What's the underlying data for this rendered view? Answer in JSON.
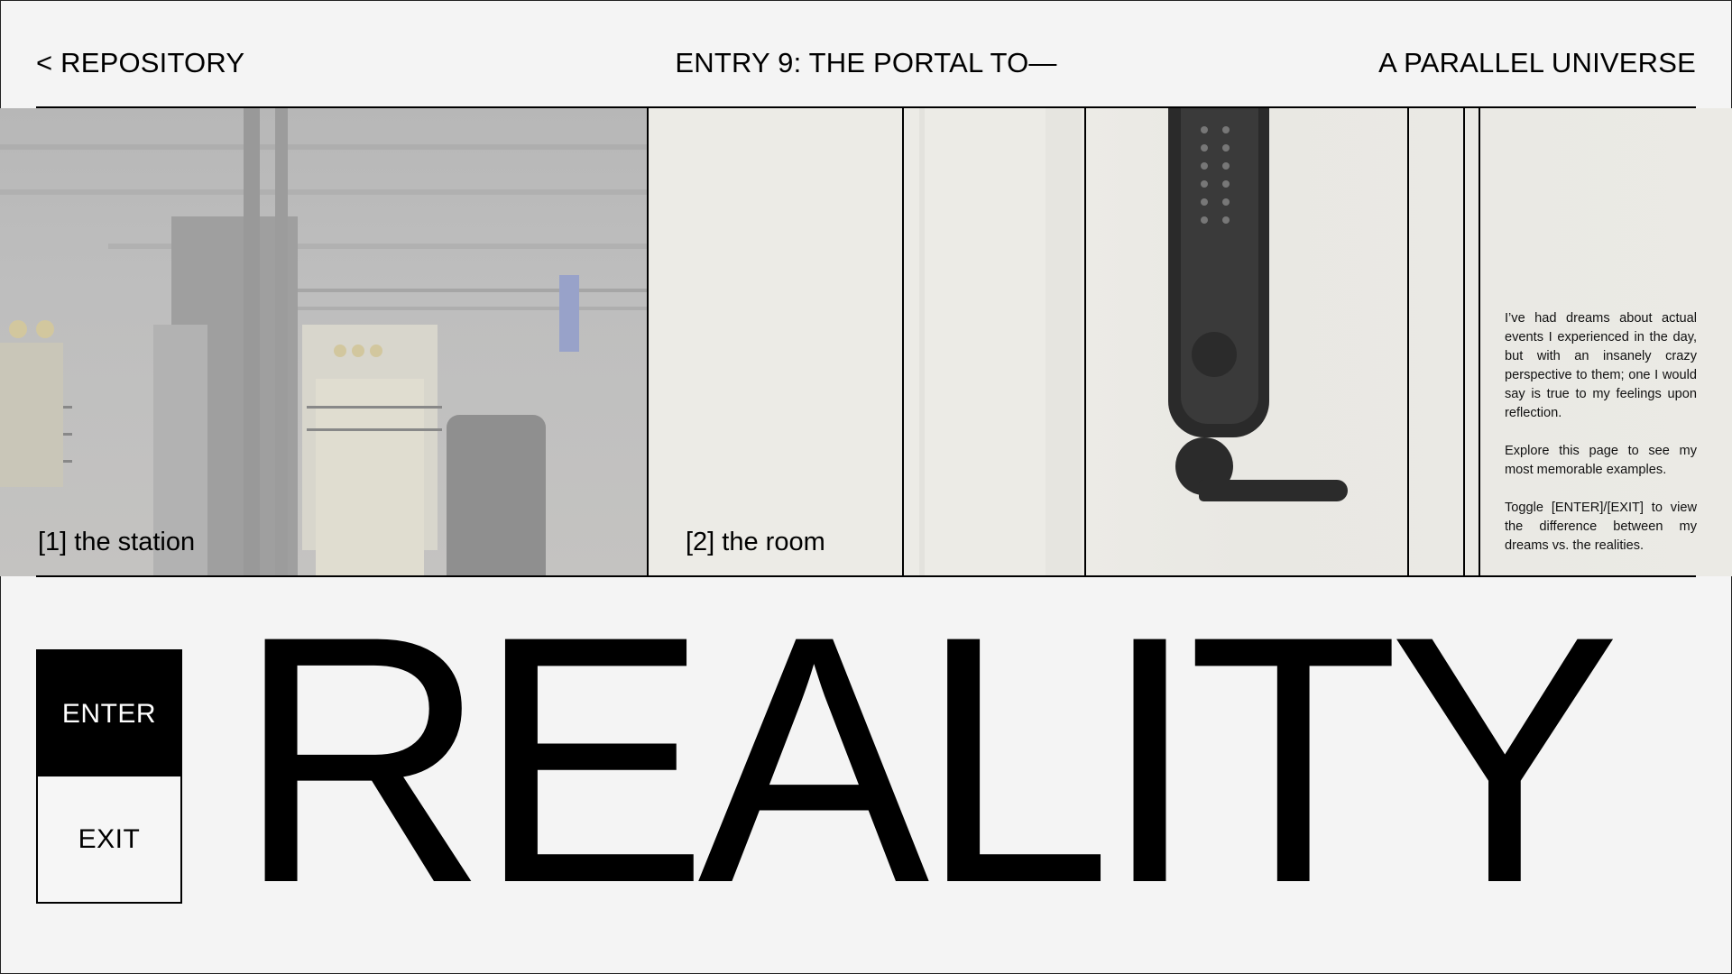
{
  "header": {
    "back_label": "< REPOSITORY",
    "entry_title": "ENTRY 9: THE PORTAL TO—",
    "subtitle": "A PARALLEL UNIVERSE"
  },
  "gallery": {
    "panels": [
      {
        "label": "[1] the station"
      },
      {
        "label": "[2] the room"
      }
    ]
  },
  "description": {
    "paragraphs": [
      "I’ve had dreams about actual events I experienced in the day, but with an insanely crazy perspective to them; one I would say is true to my feelings upon reflection.",
      "Explore this page to see my most memorable examples.",
      "Toggle [ENTER]/[EXIT] to view the difference between my dreams vs. the realities."
    ]
  },
  "toggle": {
    "enter_label": "ENTER",
    "exit_label": "EXIT",
    "selected": "ENTER"
  },
  "headline": {
    "word": "REALITY"
  },
  "colors": {
    "background": "#f4f4f4",
    "ink": "#000000",
    "active_button_bg": "#000000",
    "active_button_text": "#ffffff"
  }
}
